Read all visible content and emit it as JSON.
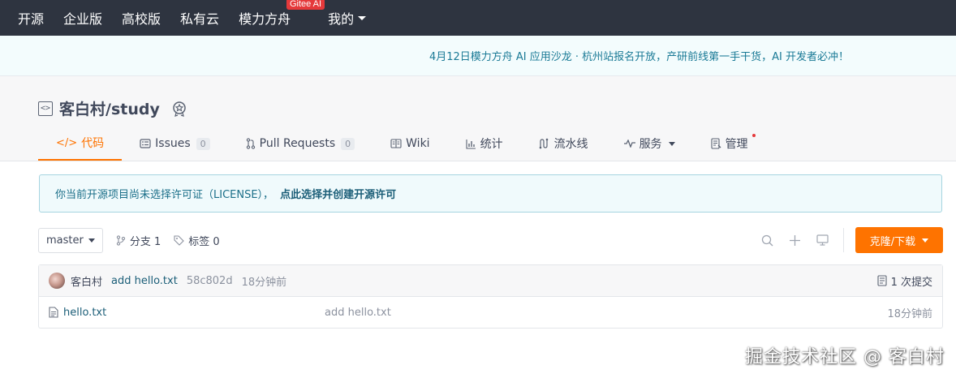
{
  "topnav": {
    "items": [
      {
        "label": "开源"
      },
      {
        "label": "企业版"
      },
      {
        "label": "高校版"
      },
      {
        "label": "私有云"
      },
      {
        "label": "模力方舟",
        "badge": "Gitee AI"
      }
    ],
    "mine_label": "我的"
  },
  "announcement": "4月12日模力方舟 AI 应用沙龙 · 杭州站报名开放，产研前线第一手干货，AI 开发者必冲！",
  "repo": {
    "title": "客白村/study",
    "tabs": [
      {
        "label": "代码",
        "icon": "code-icon"
      },
      {
        "label": "Issues",
        "count": "0",
        "icon": "issues-icon"
      },
      {
        "label": "Pull Requests",
        "count": "0",
        "icon": "pull-request-icon"
      },
      {
        "label": "Wiki",
        "icon": "wiki-icon"
      },
      {
        "label": "统计",
        "icon": "chart-icon"
      },
      {
        "label": "流水线",
        "icon": "pipeline-icon"
      },
      {
        "label": "服务",
        "icon": "service-icon"
      },
      {
        "label": "管理",
        "icon": "manage-icon"
      }
    ]
  },
  "license": {
    "text": "你当前开源项目尚未选择许可证（LICENSE），",
    "link": "点此选择并创建开源许可"
  },
  "branch": {
    "current": "master",
    "branches_label": "分支 1",
    "tags_label": "标签 0",
    "clone_label": "克隆/下载"
  },
  "commit": {
    "author": "客白村",
    "message": "add hello.txt",
    "sha": "58c802d",
    "time": "18分钟前",
    "count_label": "1 次提交"
  },
  "files": [
    {
      "name": "hello.txt",
      "message": "add hello.txt",
      "time": "18分钟前"
    }
  ],
  "watermark": "掘金技术社区 @ 客白村",
  "colors": {
    "nav_bg": "#2e3440",
    "accent": "#fe7300",
    "link": "#1b5e78",
    "badge_red": "#e5393b"
  }
}
